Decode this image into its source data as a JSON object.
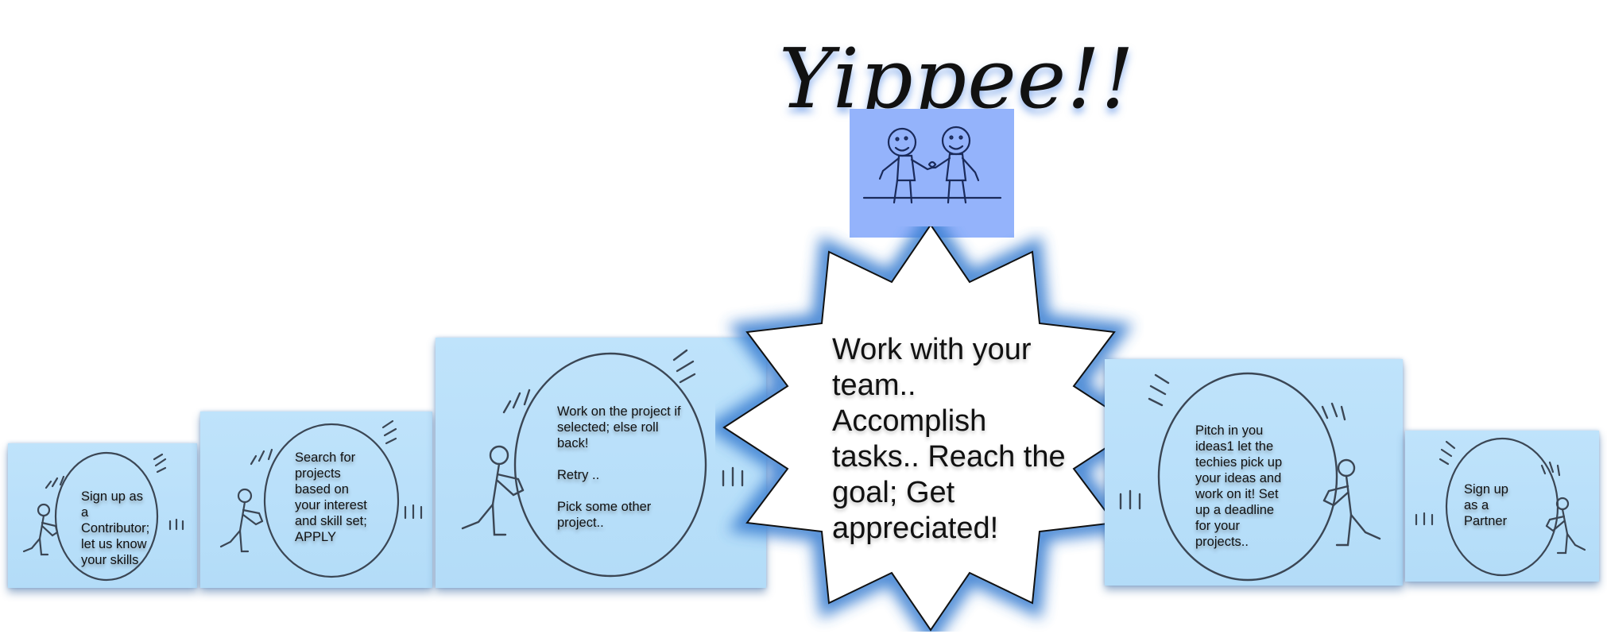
{
  "title": "Yippee!!",
  "center_text": "Work with your\nteam..\nAccomplish\ntasks.. Reach the\ngoal; Get\nappreciated!",
  "steps": [
    {
      "text": "Sign up as\na\nContributor;\nlet us know\nyour skills"
    },
    {
      "text": "Search for\nprojects\nbased on\nyour interest\nand skill set;\nAPPLY"
    },
    {
      "text": "Work on the project if\nselected; else roll\nback!\n\nRetry ..\n\nPick some other\nproject.."
    },
    {
      "text": "Pitch in you\nideas1 let the\ntechies pick up\nyour ideas and\nwork on it! Set\nup a deadline\nfor your\nprojects.."
    },
    {
      "text": "Sign up\nas a\nPartner"
    }
  ],
  "colors": {
    "panel": "#b6defa",
    "star_glow": "#3b7fd1",
    "hand_box": "#94b3fb"
  }
}
